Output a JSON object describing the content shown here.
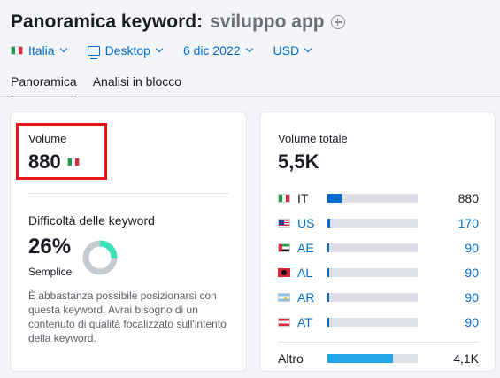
{
  "header": {
    "title": "Panoramica keyword:",
    "keyword": "sviluppo app"
  },
  "filters": {
    "country": "Italia",
    "device": "Desktop",
    "date": "6 dic 2022",
    "currency": "USD"
  },
  "tabs": [
    {
      "label": "Panoramica",
      "active": true
    },
    {
      "label": "Analisi in blocco",
      "active": false
    }
  ],
  "volume": {
    "label": "Volume",
    "value": "880",
    "flag": "it"
  },
  "difficulty": {
    "label": "Difficoltà delle keyword",
    "value": "26%",
    "level": "Semplice",
    "percent": 26,
    "color": "#3de0b8",
    "description": "È abbastanza possibile posizionarsi con questa keyword. Avrai bisogno di un contenuto di qualità focalizzato sull'intento della keyword."
  },
  "total_volume": {
    "label": "Volume totale",
    "value": "5,5K",
    "rows": [
      {
        "code": "IT",
        "flag": "it",
        "value": "880",
        "fraction": 0.16,
        "link": false
      },
      {
        "code": "US",
        "flag": "us",
        "value": "170",
        "fraction": 0.03,
        "link": true
      },
      {
        "code": "AE",
        "flag": "ae",
        "value": "90",
        "fraction": 0.016,
        "link": true
      },
      {
        "code": "AL",
        "flag": "al",
        "value": "90",
        "fraction": 0.016,
        "link": true
      },
      {
        "code": "AR",
        "flag": "ar",
        "value": "90",
        "fraction": 0.016,
        "link": true
      },
      {
        "code": "AT",
        "flag": "at",
        "value": "90",
        "fraction": 0.016,
        "link": true
      }
    ],
    "other": {
      "label": "Altro",
      "value": "4,1K",
      "fraction": 0.73
    }
  },
  "colors": {
    "accent": "#006dca",
    "highlight": "#e8141b",
    "other_bar": "#21a6e8"
  }
}
